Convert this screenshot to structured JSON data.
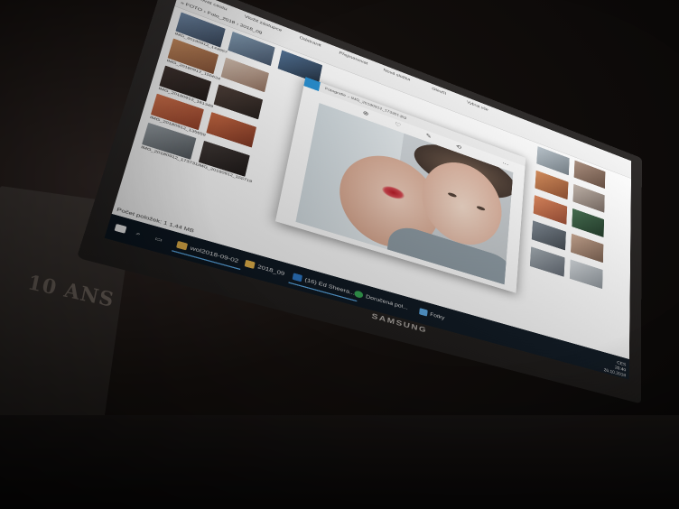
{
  "monitor": {
    "brand": "SAMSUNG"
  },
  "paper": {
    "text": "10 ANS"
  },
  "explorer": {
    "ribbon_tabs": [
      "Kopírovat cestu",
      "Vložit zástupce",
      "Odstranit",
      "Přejmenovat",
      "Nová složka",
      "Otevřít",
      "Vybrat vše"
    ],
    "breadcrumb": "« FOTO › Foto_2018 › 2018_09",
    "status": "Počet položek: 1  1,44 MB",
    "captions": [
      "IMG_20180912_143957",
      "IMG_20180912_155634",
      "IMG_20180912_161349",
      "IMG_20180912_135659",
      "IMG_20180912_173731",
      "IMG_20180912_155719"
    ]
  },
  "viewer": {
    "title": "Fotografie – IMG_20180912_173301.jpg",
    "tools": [
      "⊕",
      "♡",
      "✎",
      "⟲",
      "⋯"
    ]
  },
  "taskbar": {
    "items": [
      {
        "label": "wol2018-09-02",
        "icon_color": "#e8b54a",
        "active": true
      },
      {
        "label": "2018_09",
        "icon_color": "#e8b54a",
        "active": false
      },
      {
        "label": "(16) Ed Sheera...",
        "icon_color": "#2b78c8",
        "active": true
      },
      {
        "label": "Doručená pol...",
        "icon_color": "#34a853",
        "active": false
      },
      {
        "label": "Fotky",
        "icon_color": "#5aa9e6",
        "active": false
      }
    ],
    "time": "20:40",
    "date": "26.10.2018",
    "lang": "CES"
  },
  "colors": {
    "taskbar_bg": "#0c1620",
    "accent": "#1f8fd6",
    "wound": "#b7121e"
  }
}
